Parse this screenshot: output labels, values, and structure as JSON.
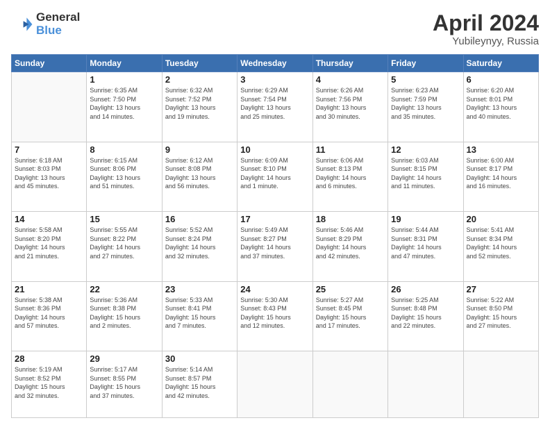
{
  "header": {
    "logo_line1": "General",
    "logo_line2": "Blue",
    "title": "April 2024",
    "location": "Yubileynyy, Russia"
  },
  "days_of_week": [
    "Sunday",
    "Monday",
    "Tuesday",
    "Wednesday",
    "Thursday",
    "Friday",
    "Saturday"
  ],
  "weeks": [
    [
      {
        "day": "",
        "info": ""
      },
      {
        "day": "1",
        "info": "Sunrise: 6:35 AM\nSunset: 7:50 PM\nDaylight: 13 hours\nand 14 minutes."
      },
      {
        "day": "2",
        "info": "Sunrise: 6:32 AM\nSunset: 7:52 PM\nDaylight: 13 hours\nand 19 minutes."
      },
      {
        "day": "3",
        "info": "Sunrise: 6:29 AM\nSunset: 7:54 PM\nDaylight: 13 hours\nand 25 minutes."
      },
      {
        "day": "4",
        "info": "Sunrise: 6:26 AM\nSunset: 7:56 PM\nDaylight: 13 hours\nand 30 minutes."
      },
      {
        "day": "5",
        "info": "Sunrise: 6:23 AM\nSunset: 7:59 PM\nDaylight: 13 hours\nand 35 minutes."
      },
      {
        "day": "6",
        "info": "Sunrise: 6:20 AM\nSunset: 8:01 PM\nDaylight: 13 hours\nand 40 minutes."
      }
    ],
    [
      {
        "day": "7",
        "info": "Sunrise: 6:18 AM\nSunset: 8:03 PM\nDaylight: 13 hours\nand 45 minutes."
      },
      {
        "day": "8",
        "info": "Sunrise: 6:15 AM\nSunset: 8:06 PM\nDaylight: 13 hours\nand 51 minutes."
      },
      {
        "day": "9",
        "info": "Sunrise: 6:12 AM\nSunset: 8:08 PM\nDaylight: 13 hours\nand 56 minutes."
      },
      {
        "day": "10",
        "info": "Sunrise: 6:09 AM\nSunset: 8:10 PM\nDaylight: 14 hours\nand 1 minute."
      },
      {
        "day": "11",
        "info": "Sunrise: 6:06 AM\nSunset: 8:13 PM\nDaylight: 14 hours\nand 6 minutes."
      },
      {
        "day": "12",
        "info": "Sunrise: 6:03 AM\nSunset: 8:15 PM\nDaylight: 14 hours\nand 11 minutes."
      },
      {
        "day": "13",
        "info": "Sunrise: 6:00 AM\nSunset: 8:17 PM\nDaylight: 14 hours\nand 16 minutes."
      }
    ],
    [
      {
        "day": "14",
        "info": "Sunrise: 5:58 AM\nSunset: 8:20 PM\nDaylight: 14 hours\nand 21 minutes."
      },
      {
        "day": "15",
        "info": "Sunrise: 5:55 AM\nSunset: 8:22 PM\nDaylight: 14 hours\nand 27 minutes."
      },
      {
        "day": "16",
        "info": "Sunrise: 5:52 AM\nSunset: 8:24 PM\nDaylight: 14 hours\nand 32 minutes."
      },
      {
        "day": "17",
        "info": "Sunrise: 5:49 AM\nSunset: 8:27 PM\nDaylight: 14 hours\nand 37 minutes."
      },
      {
        "day": "18",
        "info": "Sunrise: 5:46 AM\nSunset: 8:29 PM\nDaylight: 14 hours\nand 42 minutes."
      },
      {
        "day": "19",
        "info": "Sunrise: 5:44 AM\nSunset: 8:31 PM\nDaylight: 14 hours\nand 47 minutes."
      },
      {
        "day": "20",
        "info": "Sunrise: 5:41 AM\nSunset: 8:34 PM\nDaylight: 14 hours\nand 52 minutes."
      }
    ],
    [
      {
        "day": "21",
        "info": "Sunrise: 5:38 AM\nSunset: 8:36 PM\nDaylight: 14 hours\nand 57 minutes."
      },
      {
        "day": "22",
        "info": "Sunrise: 5:36 AM\nSunset: 8:38 PM\nDaylight: 15 hours\nand 2 minutes."
      },
      {
        "day": "23",
        "info": "Sunrise: 5:33 AM\nSunset: 8:41 PM\nDaylight: 15 hours\nand 7 minutes."
      },
      {
        "day": "24",
        "info": "Sunrise: 5:30 AM\nSunset: 8:43 PM\nDaylight: 15 hours\nand 12 minutes."
      },
      {
        "day": "25",
        "info": "Sunrise: 5:27 AM\nSunset: 8:45 PM\nDaylight: 15 hours\nand 17 minutes."
      },
      {
        "day": "26",
        "info": "Sunrise: 5:25 AM\nSunset: 8:48 PM\nDaylight: 15 hours\nand 22 minutes."
      },
      {
        "day": "27",
        "info": "Sunrise: 5:22 AM\nSunset: 8:50 PM\nDaylight: 15 hours\nand 27 minutes."
      }
    ],
    [
      {
        "day": "28",
        "info": "Sunrise: 5:19 AM\nSunset: 8:52 PM\nDaylight: 15 hours\nand 32 minutes."
      },
      {
        "day": "29",
        "info": "Sunrise: 5:17 AM\nSunset: 8:55 PM\nDaylight: 15 hours\nand 37 minutes."
      },
      {
        "day": "30",
        "info": "Sunrise: 5:14 AM\nSunset: 8:57 PM\nDaylight: 15 hours\nand 42 minutes."
      },
      {
        "day": "",
        "info": ""
      },
      {
        "day": "",
        "info": ""
      },
      {
        "day": "",
        "info": ""
      },
      {
        "day": "",
        "info": ""
      }
    ]
  ]
}
